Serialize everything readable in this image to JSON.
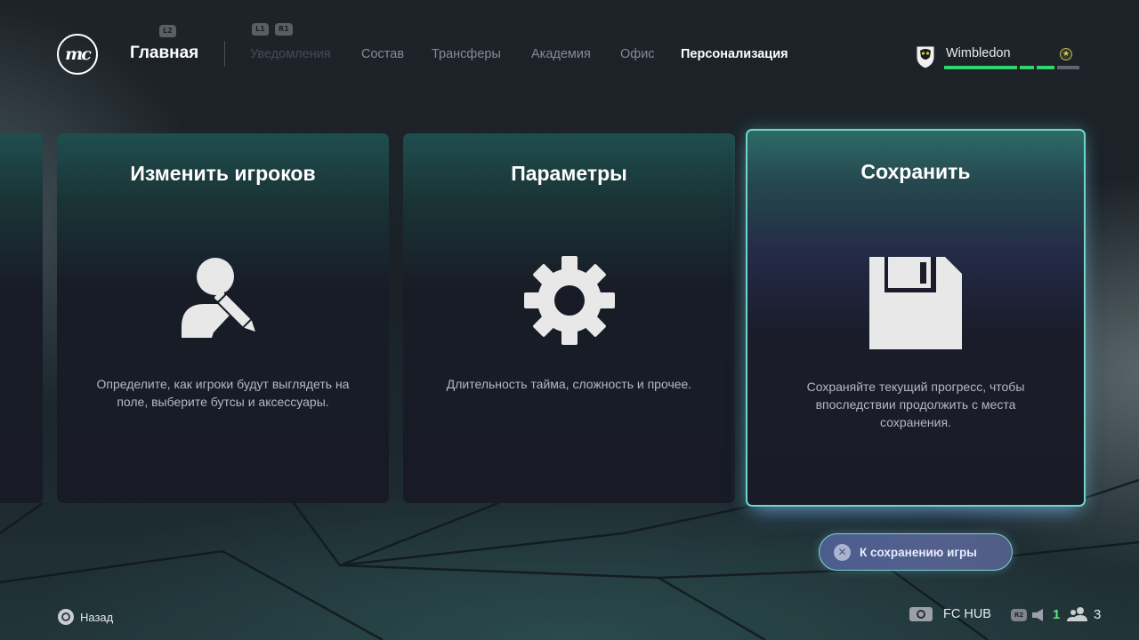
{
  "header": {
    "logo_text": "mc",
    "hint_l2": "L2",
    "hint_l1": "L1",
    "hint_r1": "R1",
    "home_label": "Главная",
    "nav": [
      {
        "label": "Уведомления",
        "state": "disabled"
      },
      {
        "label": "Состав",
        "state": "normal"
      },
      {
        "label": "Трансферы",
        "state": "normal"
      },
      {
        "label": "Академия",
        "state": "normal"
      },
      {
        "label": "Офис",
        "state": "normal"
      },
      {
        "label": "Персонализация",
        "state": "active"
      }
    ],
    "team": {
      "name": "Wimbledon",
      "badge_icon": "wimbledon-crest-icon",
      "progress_segments_filled": 4,
      "progress_segments_total": 5,
      "star_icon": "star-icon",
      "accent_color": "#2fd46a"
    }
  },
  "cards": [
    {
      "title": "Изменить игроков",
      "icon": "edit-player-icon",
      "description": "Определите, как игроки будут выглядеть на поле, выберите бутсы и аксессуары."
    },
    {
      "title": "Параметры",
      "icon": "gear-icon",
      "description": "Длительность тайма, сложность и прочее."
    },
    {
      "title": "Сохранить",
      "icon": "floppy-disk-icon",
      "selected": true,
      "description": "Сохраняйте текущий прогресс, чтобы впоследствии продолжить с места сохранения."
    }
  ],
  "action": {
    "label": "К сохранению игры",
    "button_icon": "cross-button-icon"
  },
  "footer": {
    "back_label": "Назад",
    "back_icon": "circle-button-icon",
    "hub_label": "FC HUB",
    "hub_icon": "touchpad-icon",
    "r2_hint": "R2",
    "notifications_count": "1",
    "friends_count": "3"
  },
  "colors": {
    "selection_border": "#6fd6c9",
    "green": "#5be37b"
  }
}
